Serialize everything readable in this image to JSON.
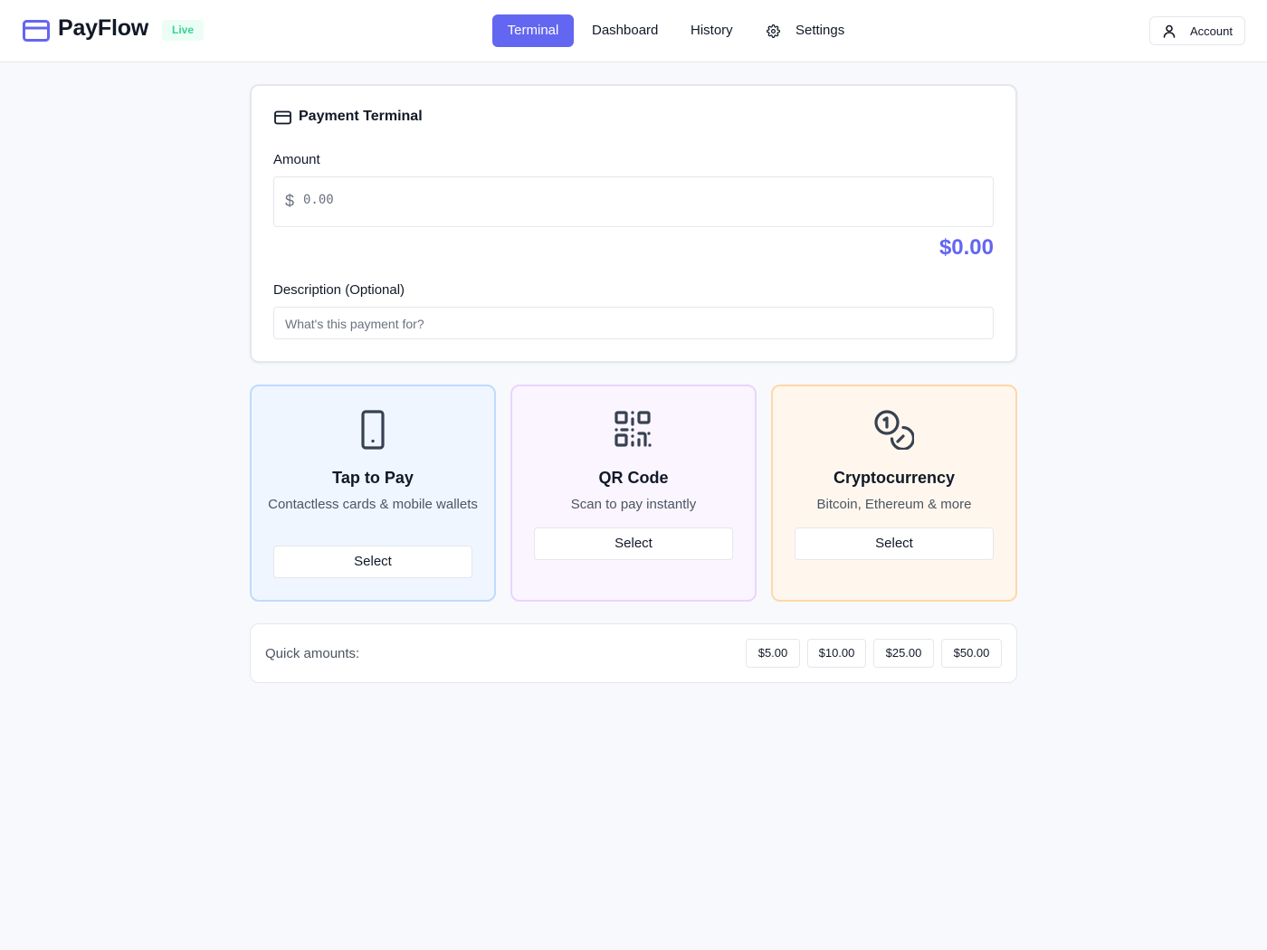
{
  "app": {
    "name": "PayFlow",
    "status_badge": "Live",
    "accent_color": "#6366f1"
  },
  "nav": {
    "items": [
      {
        "label": "Terminal",
        "active": true
      },
      {
        "label": "Dashboard",
        "active": false
      },
      {
        "label": "History",
        "active": false
      },
      {
        "label": "Settings",
        "active": false,
        "icon": "gear-icon"
      }
    ],
    "account_label": "Account"
  },
  "terminal": {
    "title": "Payment Terminal",
    "amount_label": "Amount",
    "currency_symbol": "$",
    "amount_placeholder": "0.00",
    "amount_display": "$0.00",
    "description_label": "Description (Optional)",
    "description_placeholder": "What's this payment for?"
  },
  "methods": [
    {
      "title": "Tap to Pay",
      "subtitle": "Contactless cards & mobile wallets",
      "button": "Select",
      "icon": "smartphone-icon"
    },
    {
      "title": "QR Code",
      "subtitle": "Scan to pay instantly",
      "button": "Select",
      "icon": "qr-code-icon"
    },
    {
      "title": "Cryptocurrency",
      "subtitle": "Bitcoin, Ethereum & more",
      "button": "Select",
      "icon": "coins-icon"
    }
  ],
  "quick_amounts": {
    "label": "Quick amounts:",
    "values": [
      "$5.00",
      "$10.00",
      "$25.00",
      "$50.00"
    ]
  }
}
